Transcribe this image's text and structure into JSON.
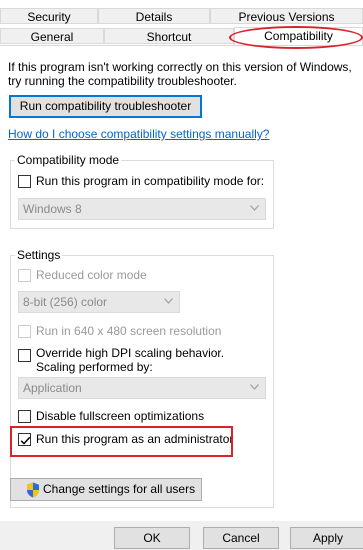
{
  "tabs": {
    "row1": [
      "Security",
      "Details",
      "Previous Versions"
    ],
    "row2": [
      "General",
      "Shortcut",
      "Compatibility"
    ]
  },
  "intro": {
    "line1": "If this program isn't working correctly on this version of Windows,",
    "line2": "try running the compatibility troubleshooter."
  },
  "troubleshoot_button": "Run compatibility troubleshooter",
  "manual_link": "How do I choose compatibility settings manually?",
  "compat_mode": {
    "legend": "Compatibility mode",
    "checkbox_label": "Run this program in compatibility mode for:",
    "checked": false,
    "select_value": "Windows 8"
  },
  "settings": {
    "legend": "Settings",
    "reduced_color": "Reduced color mode",
    "color_select": "8-bit (256) color",
    "run_640": "Run in 640 x 480 screen resolution",
    "dpi_line1": "Override high DPI scaling behavior.",
    "dpi_line2": "Scaling performed by:",
    "dpi_select": "Application",
    "disable_fullscreen": "Disable fullscreen optimizations",
    "run_admin": "Run this program as an administrator",
    "run_admin_checked": true
  },
  "change_all_button": "Change settings for all users",
  "footer": {
    "ok": "OK",
    "cancel": "Cancel",
    "apply": "Apply"
  },
  "colors": {
    "highlight": "#d9232a",
    "link": "#0066cc",
    "focus": "#0078d7"
  },
  "icons": {
    "shield": "uac-shield-icon",
    "check": "checkmark-icon",
    "dropdown": "chevron-down-icon"
  }
}
